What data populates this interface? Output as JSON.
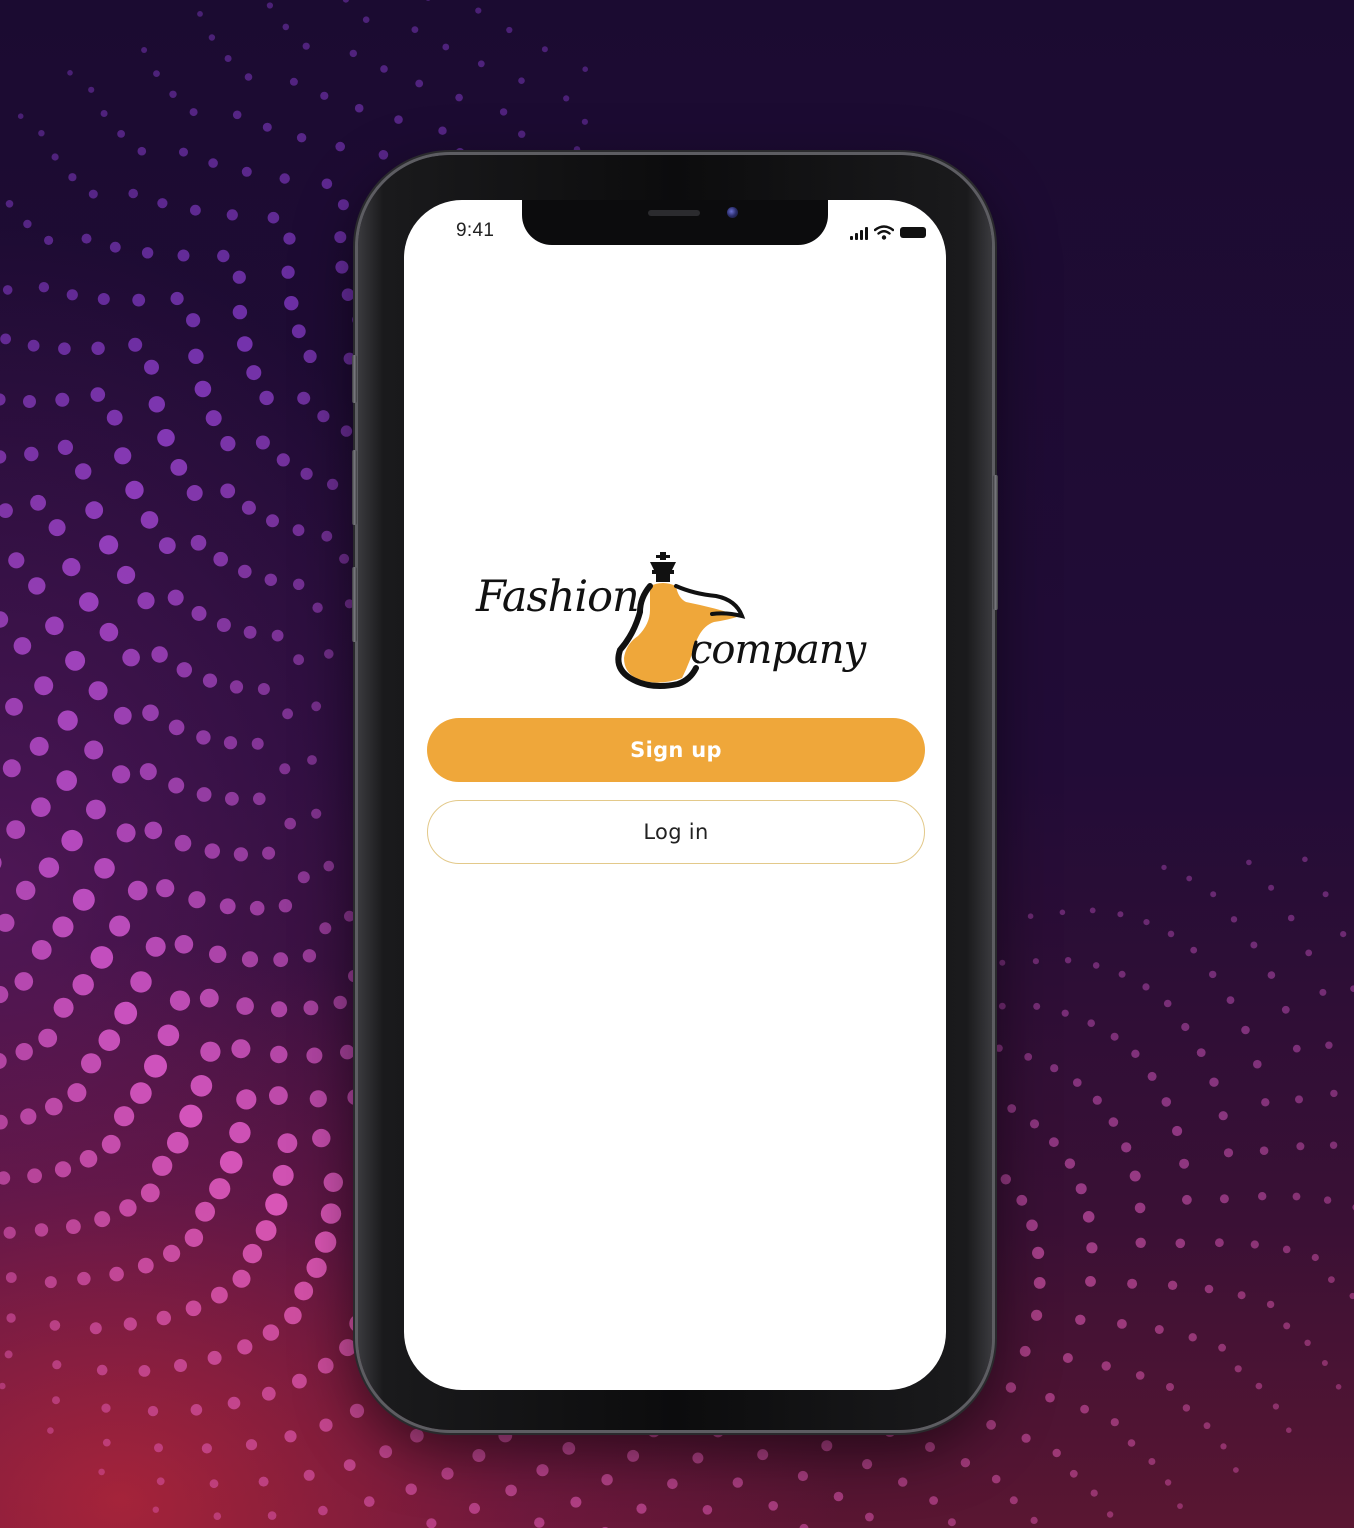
{
  "status_bar": {
    "time": "9:41",
    "icons": [
      "cellular-signal-icon",
      "wifi-icon",
      "battery-icon"
    ]
  },
  "logo": {
    "word_1": "Fashion",
    "word_2": "company",
    "emblem": "dress-mannequin-icon",
    "accent_color": "#efa73a"
  },
  "actions": {
    "signup_label": "Sign up",
    "login_label": "Log in"
  },
  "colors": {
    "primary": "#efa73a",
    "outline": "#e3c98a",
    "background_dark": "#1c0b33",
    "dots_purple": "#8e3fd6",
    "dots_pink": "#e55bb8"
  }
}
